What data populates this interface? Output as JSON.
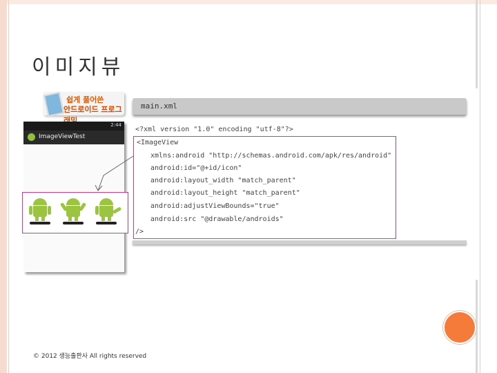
{
  "slide": {
    "title": "이미지뷰",
    "footer": "© 2012 생능출판사  All rights reserved"
  },
  "logo": {
    "line1": "쉽게 풀어쓴",
    "line2": "안드로이드 프로그래밍"
  },
  "filebar": {
    "filename": "main.xml"
  },
  "phone": {
    "status_time": "2:44",
    "app_title": "ImageViewTest"
  },
  "code": {
    "line1": "<?xml version \"1.0\" encoding \"utf-8\"?>",
    "line2": "<ImageView",
    "line3": "xmlns:android \"http://schemas.android.com/apk/res/android\"",
    "line4": "android:id=\"@+id/icon\"",
    "line5": "android:layout_width \"match_parent\"",
    "line6": "android:layout_height \"match_parent\"",
    "line7": "android:adjustViewBounds=\"true\"",
    "line8": "android:src \"@drawable/androids\"",
    "line9": "/>"
  },
  "colors": {
    "accent": "#d4378c",
    "circle": "#f47b3a",
    "android_green": "#9bc440"
  }
}
